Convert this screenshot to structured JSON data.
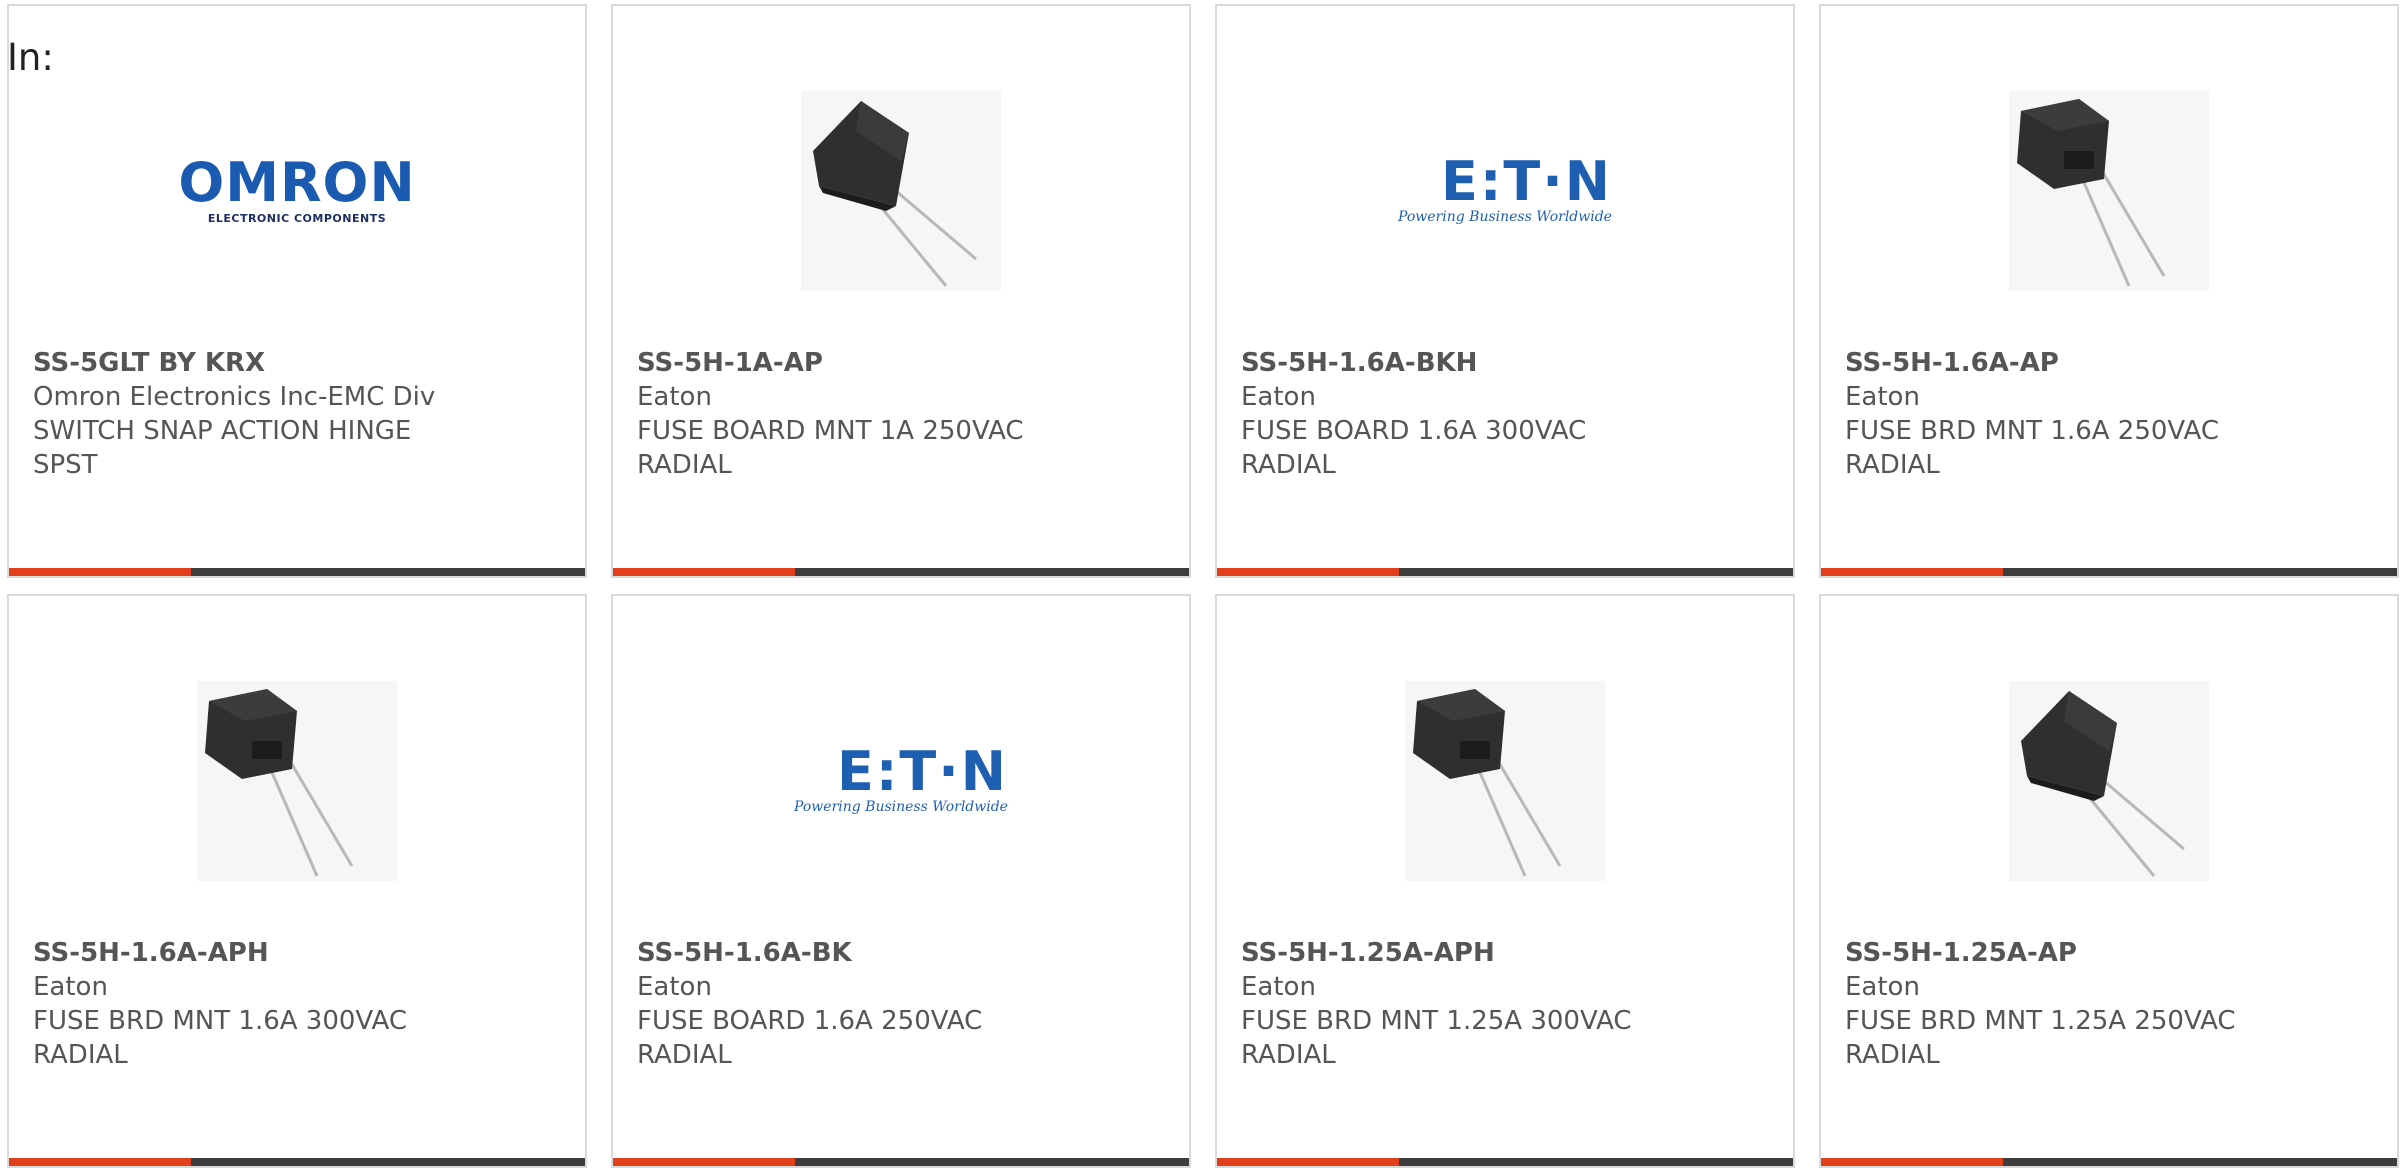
{
  "filter": {
    "label": "In:"
  },
  "products": [
    {
      "part_number": "SS-5GLT BY KRX",
      "manufacturer": "Omron Electronics Inc-EMC Div",
      "description": "SWITCH SNAP ACTION HINGE SPST",
      "image": {
        "kind": "logo",
        "brand": "omron",
        "word": "OMRON",
        "sub": "ELECTRONIC COMPONENTS"
      }
    },
    {
      "part_number": "SS-5H-1A-AP",
      "manufacturer": "Eaton",
      "description": "FUSE BOARD MNT 1A 250VAC RADIAL",
      "image": {
        "kind": "photo",
        "variant": "tilted"
      }
    },
    {
      "part_number": "SS-5H-1.6A-BKH",
      "manufacturer": "Eaton",
      "description": "FUSE BOARD 1.6A 300VAC RADIAL",
      "image": {
        "kind": "logo",
        "brand": "eaton",
        "word": "E:T·N",
        "sub": "Powering Business Worldwide"
      }
    },
    {
      "part_number": "SS-5H-1.6A-AP",
      "manufacturer": "Eaton",
      "description": "FUSE BRD MNT 1.6A 250VAC RADIAL",
      "image": {
        "kind": "photo",
        "variant": "upright"
      }
    },
    {
      "part_number": "SS-5H-1.6A-APH",
      "manufacturer": "Eaton",
      "description": "FUSE BRD MNT 1.6A 300VAC RADIAL",
      "image": {
        "kind": "photo",
        "variant": "upright"
      }
    },
    {
      "part_number": "SS-5H-1.6A-BK",
      "manufacturer": "Eaton",
      "description": "FUSE BOARD 1.6A 250VAC RADIAL",
      "image": {
        "kind": "logo",
        "brand": "eaton",
        "word": "E:T·N",
        "sub": "Powering Business Worldwide"
      }
    },
    {
      "part_number": "SS-5H-1.25A-APH",
      "manufacturer": "Eaton",
      "description": "FUSE BRD MNT 1.25A 300VAC RADIAL",
      "image": {
        "kind": "photo",
        "variant": "upright"
      }
    },
    {
      "part_number": "SS-5H-1.25A-AP",
      "manufacturer": "Eaton",
      "description": "FUSE BRD MNT 1.25A 250VAC RADIAL",
      "image": {
        "kind": "photo",
        "variant": "tilted"
      }
    }
  ],
  "colors": {
    "accent": "#e2401c",
    "bar": "#3d3d3d",
    "text": "#555555",
    "brand_blue": "#1f5fb2"
  }
}
